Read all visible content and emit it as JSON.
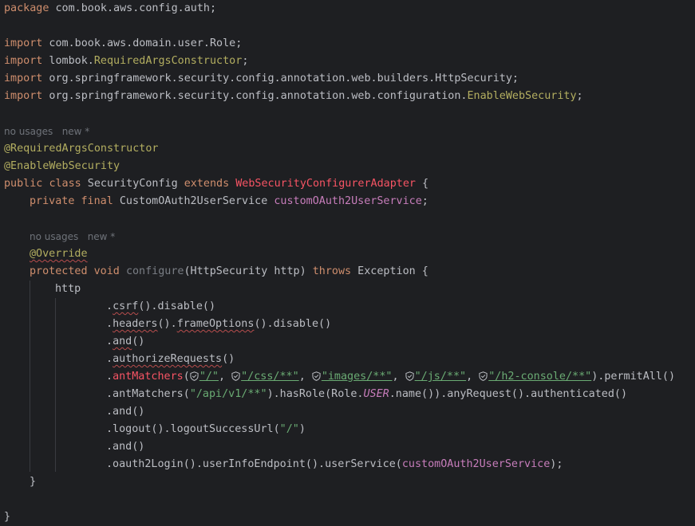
{
  "lines": {
    "pkg_kw": "package",
    "pkg_name": " com.book.aws.config.auth;",
    "imp": "import",
    "imp1": " com.book.aws.domain.user.Role;",
    "imp2_a": " lombok.",
    "imp2_b": "RequiredArgsConstructor",
    "imp2_c": ";",
    "imp3": " org.springframework.security.config.annotation.web.builders.HttpSecurity;",
    "imp4_a": " org.springframework.security.config.annotation.web.configuration.",
    "imp4_b": "EnableWebSecurity",
    "imp4_c": ";",
    "usage_hint": "no usages",
    "new_hint": "new *",
    "ann1": "@RequiredArgsConstructor",
    "ann2": "@EnableWebSecurity",
    "public": "public",
    "class": "class",
    "class_name": " SecurityConfig ",
    "extends": "extends",
    "super": "WebSecurityConfigurerAdapter",
    "brace_open": " {",
    "private": "private",
    "final": "final",
    "field_type": " CustomOAuth2UserService ",
    "field_name": "customOAuth2UserService",
    "semicolon": ";",
    "override": "@Override",
    "protected": "protected",
    "void": "void",
    "method": "configure",
    "params": "(HttpSecurity http) ",
    "throws": "throws",
    "exception": " Exception {",
    "http": "http",
    "csrf_a": ".",
    "csrf_b": "csrf",
    "csrf_c": "().disable()",
    "headers_a": ".",
    "headers_b": "headers",
    "headers_c": "().",
    "headers_d": "frameOptions",
    "headers_e": "().disable()",
    "and_a": ".",
    "and_b": "and",
    "and_c": "()",
    "auth_a": ".",
    "auth_b": "authorizeRequests",
    "auth_c": "()",
    "ant_a": ".",
    "ant_b": "antMatchers",
    "ant_c": "(",
    "s1": "\"/\"",
    "s2": "\"/css/**\"",
    "s3": "\"images/**\"",
    "s4": "\"/js/**\"",
    "s5": "\"/h2-console/**\"",
    "comma": ", ",
    "permit": ").permitAll()",
    "ant2_a": ".antMatchers(",
    "ant2_s": "\"/api/v1/**\"",
    "ant2_b": ").hasRole(Role.",
    "ant2_user": "USER",
    "ant2_c": ".name()).anyRequest().authenticated()",
    "and2": ".and()",
    "logout_a": ".logout().logoutSuccessUrl(",
    "logout_s": "\"/\"",
    "logout_c": ")",
    "and3": ".and()",
    "oauth_a": ".oauth2Login().userInfoEndpoint().userService(",
    "oauth_f": "customOAuth2UserService",
    "oauth_c": ");",
    "close_method": "}",
    "close_class": "}"
  },
  "icons": {
    "shield": "shield-check-icon"
  },
  "colors": {
    "background": "#1e1f22",
    "keyword": "#cf8e6d",
    "annotation": "#b3ae60",
    "field": "#c77dbb",
    "string": "#6aab73",
    "text": "#bcbec4",
    "hint": "#6f737a",
    "error": "#f75464"
  }
}
